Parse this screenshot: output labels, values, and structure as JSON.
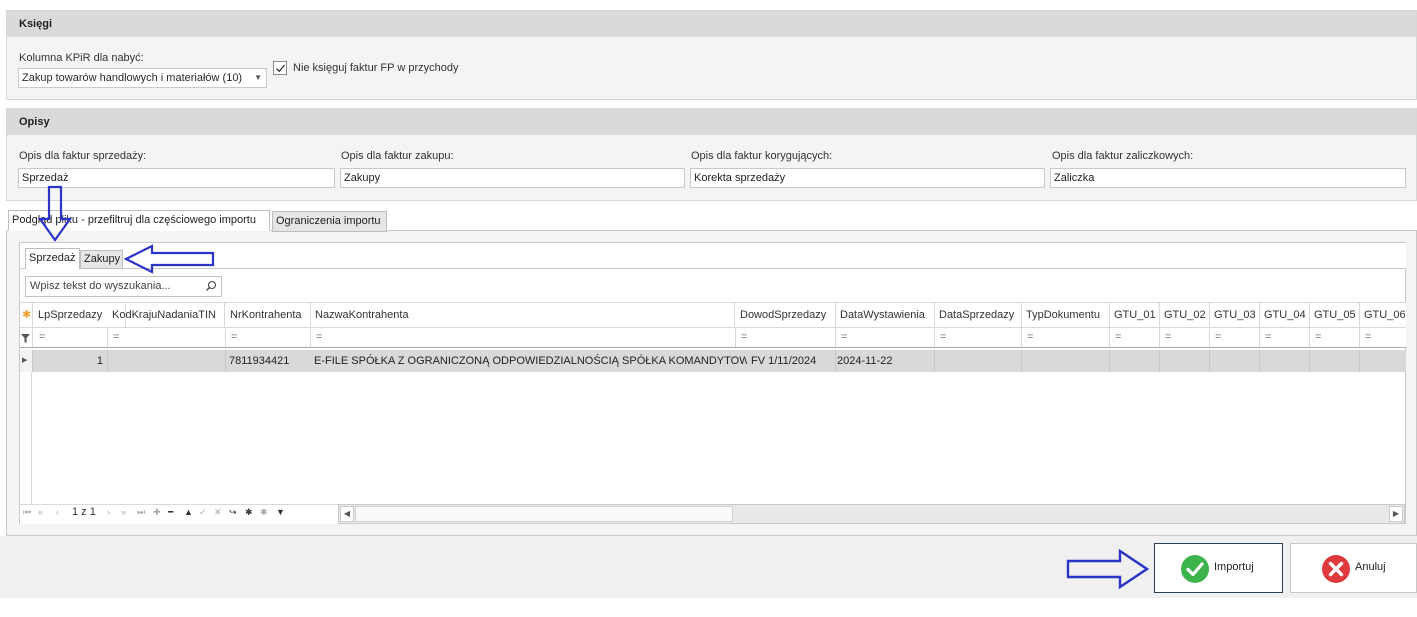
{
  "ksiegi": {
    "title": "Księgi",
    "kpir_label": "Kolumna KPiR dla nabyć:",
    "kpir_value": "Zakup towarów handlowych i materiałów (10)",
    "checkbox_label": "Nie księguj faktur FP w przychody",
    "checkbox_checked": true
  },
  "opisy": {
    "title": "Opisy",
    "fields": [
      {
        "label": "Opis dla faktur sprzedaży:",
        "value": "Sprzedaż"
      },
      {
        "label": "Opis dla faktur zakupu:",
        "value": "Zakupy"
      },
      {
        "label": "Opis dla faktur korygujących:",
        "value": "Korekta sprzedaży"
      },
      {
        "label": "Opis dla faktur zaliczkowych:",
        "value": "Zaliczka"
      }
    ]
  },
  "main_tabs": [
    {
      "label": "Podgląd pliku - przefiltruj dla częściowego importu",
      "active": true
    },
    {
      "label": "Ograniczenia importu",
      "active": false
    }
  ],
  "sub_tabs": [
    {
      "label": "Sprzedaż",
      "active": true
    },
    {
      "label": "Zakupy",
      "active": false
    }
  ],
  "search": {
    "placeholder": "Wpisz tekst do wyszukania..."
  },
  "grid": {
    "columns": [
      "LpSprzedazy",
      "KodKrajuNadaniaTIN",
      "NrKontrahenta",
      "NazwaKontrahenta",
      "DowodSprzedazy",
      "DataWystawienia",
      "DataSprzedazy",
      "TypDokumentu",
      "GTU_01",
      "GTU_02",
      "GTU_03",
      "GTU_04",
      "GTU_05",
      "GTU_06"
    ],
    "filter_symbol": "=",
    "rows": [
      [
        "1",
        "",
        "7811934421",
        "E-FILE SPÓŁKA Z OGRANICZONĄ ODPOWIEDZIALNOŚCIĄ SPÓŁKA KOMANDYTOWA",
        "FV 1/11/2024",
        "2024-11-22",
        "",
        "",
        "",
        "",
        "",
        "",
        "",
        ""
      ]
    ]
  },
  "navigator": {
    "page_text": "1 z 1"
  },
  "buttons": {
    "import": "Importuj",
    "cancel": "Anuluj"
  },
  "colors": {
    "accent_green": "#3cb44b",
    "cancel_red": "#e03a3e",
    "annotation_blue": "#2a35c8"
  }
}
